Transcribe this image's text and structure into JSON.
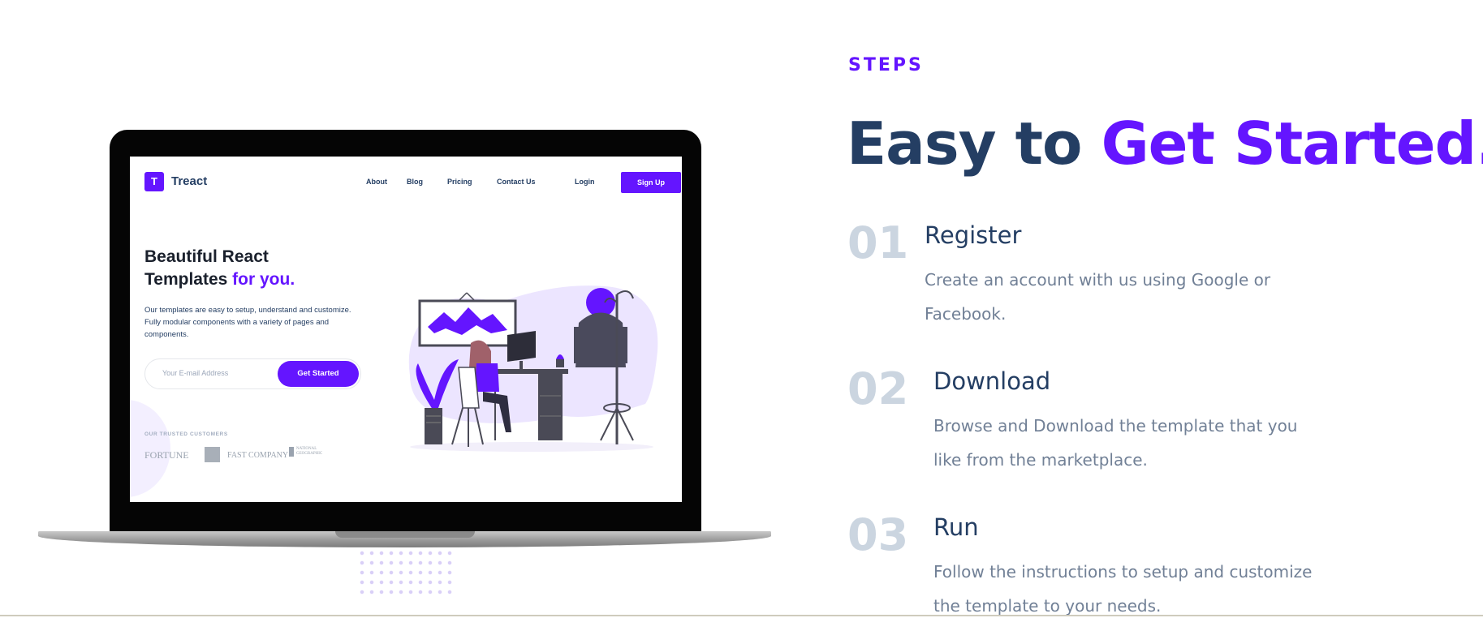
{
  "laptop": {
    "site": {
      "logo_letter": "T",
      "logo_text": "Treact",
      "nav": [
        "About",
        "Blog",
        "Pricing",
        "Contact Us",
        "Login"
      ],
      "signup_label": "Sign Up",
      "hero_title_line1": "Beautiful React",
      "hero_title_line2": "Templates ",
      "hero_title_accent": "for you.",
      "hero_desc": "Our templates are easy to setup, understand and customize. Fully modular components with a variety of pages and components.",
      "email_placeholder": "Your E-mail Address",
      "get_started_label": "Get Started",
      "trusted_label": "OUR TRUSTED CUSTOMERS",
      "brands": [
        "FORTUNE",
        "FAST COMPANY",
        "NATIONAL GEOGRAPHIC"
      ]
    }
  },
  "section": {
    "label": "STEPS",
    "heading": "Easy to ",
    "heading_accent": "Get Started."
  },
  "steps": [
    {
      "number": "01",
      "title": "Register",
      "desc": "Create an account with us using Google or Facebook."
    },
    {
      "number": "02",
      "title": "Download",
      "desc": "Browse and Download the template that you like from the marketplace."
    },
    {
      "number": "03",
      "title": "Run",
      "desc": "Follow the instructions to setup and customize the template to your needs."
    }
  ],
  "colors": {
    "primary": "#6415ff",
    "heading": "#243e63",
    "muted": "#718096",
    "number": "#cbd5e0"
  }
}
